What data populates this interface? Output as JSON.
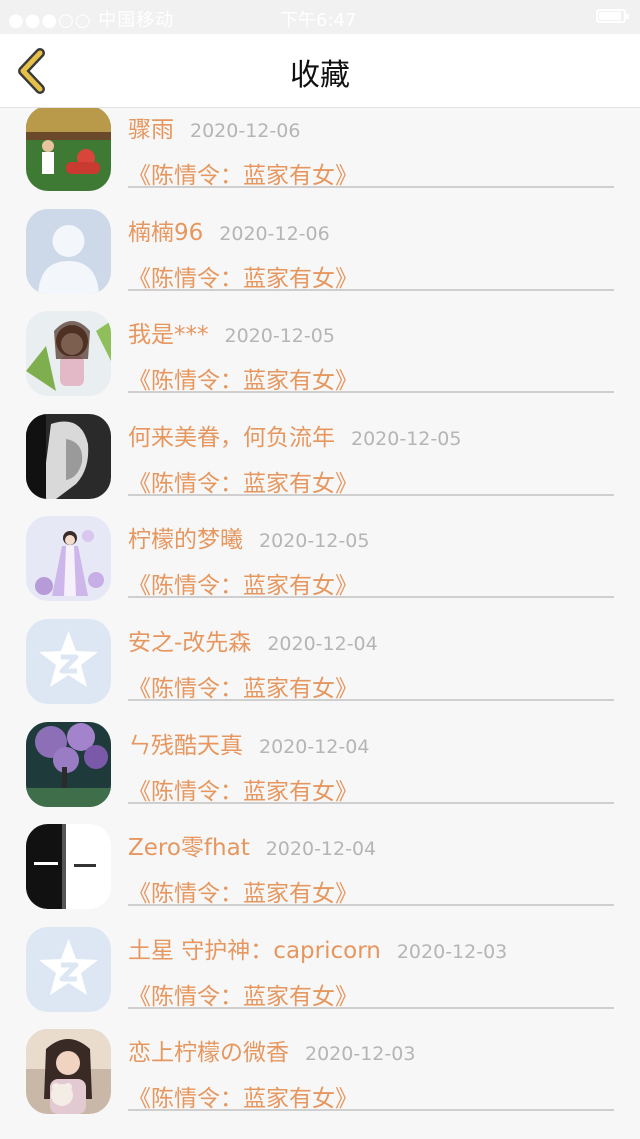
{
  "status_bar": {
    "carrier": "●●●○○ 中国移动",
    "time": "下午6:47"
  },
  "nav": {
    "title": "收藏",
    "back_icon": "chevron-left-icon"
  },
  "colors": {
    "accent": "#e6975f",
    "back_icon": "#e5c14a",
    "date": "#b5b5b5",
    "divider": "#cfcfcf"
  },
  "favorites": [
    {
      "name": "骤雨",
      "date": "2020-12-06",
      "work": "《陈情令：蓝家有女》",
      "avatar": "football-photo"
    },
    {
      "name": "楠楠96",
      "date": "2020-12-06",
      "work": "《陈情令：蓝家有女》",
      "avatar": "default-avatar"
    },
    {
      "name": "我是***",
      "date": "2020-12-05",
      "work": "《陈情令：蓝家有女》",
      "avatar": "anime-girl"
    },
    {
      "name": "何来美眷，何负流年",
      "date": "2020-12-05",
      "work": "《陈情令：蓝家有女》",
      "avatar": "bw-portrait"
    },
    {
      "name": "柠檬的梦曦",
      "date": "2020-12-05",
      "work": "《陈情令：蓝家有女》",
      "avatar": "flower-lady"
    },
    {
      "name": "安之-改先森",
      "date": "2020-12-04",
      "work": "《陈情令：蓝家有女》",
      "avatar": "qq-default"
    },
    {
      "name": "ㄣ残酷天真",
      "date": "2020-12-04",
      "work": "《陈情令：蓝家有女》",
      "avatar": "purple-tree"
    },
    {
      "name": "Zero零fhat",
      "date": "2020-12-04",
      "work": "《陈情令：蓝家有女》",
      "avatar": "black-white-text"
    },
    {
      "name": "土星 守护神：capricorn",
      "date": "2020-12-03",
      "work": "《陈情令：蓝家有女》",
      "avatar": "qq-default"
    },
    {
      "name": "恋上柠檬の微香",
      "date": "2020-12-03",
      "work": "《陈情令：蓝家有女》",
      "avatar": "girl-with-toy"
    }
  ]
}
